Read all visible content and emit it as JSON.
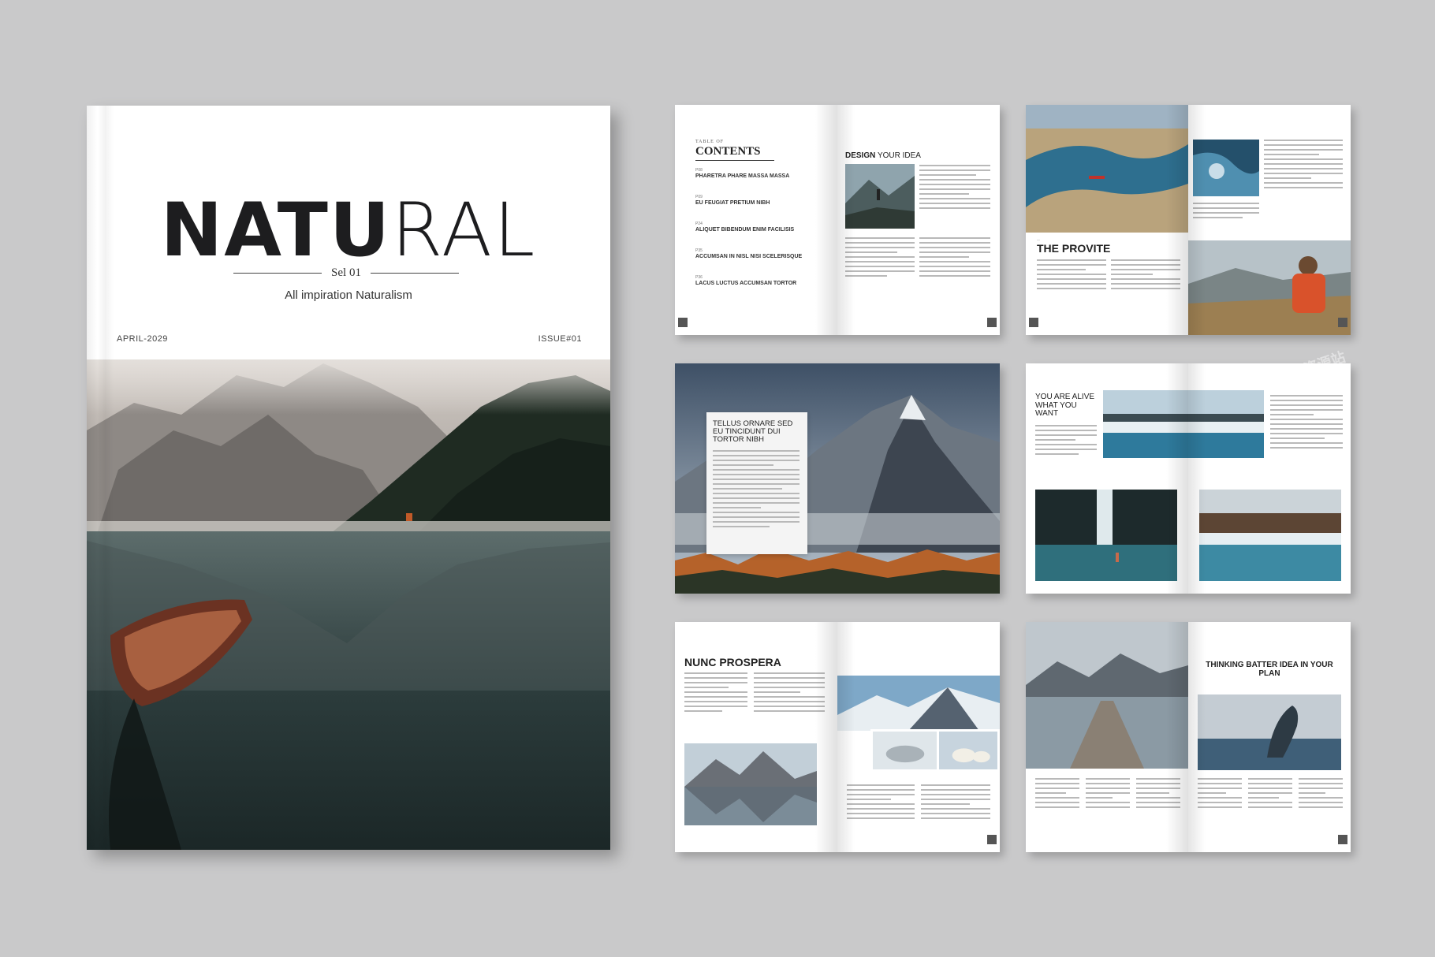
{
  "cover": {
    "title_bold": "NATU",
    "title_light": "RAL",
    "sel": "Sel 01",
    "subtitle": "All impiration Naturalism",
    "date": "APRIL-2029",
    "issue": "ISSUE#01"
  },
  "spreads": {
    "toc": {
      "label": "TABLE OF",
      "title": "CONTENTS",
      "items": [
        {
          "num": "P08",
          "text": "PHARETRA PHARE MASSA MASSA"
        },
        {
          "num": "P09",
          "text": "EU FEUGIAT PRETIUM NIBH"
        },
        {
          "num": "P24",
          "text": "ALIQUET BIBENDUM ENIM FACILISIS"
        },
        {
          "num": "P35",
          "text": "ACCUMSAN IN NISL NISI SCELERISQUE"
        },
        {
          "num": "P36",
          "text": "LACUS LUCTUS ACCUMSAN TORTOR"
        }
      ],
      "right_heading_bold": "DESIGN",
      "right_heading_light": " YOUR IDEA"
    },
    "provite": {
      "heading": "THE PROVITE"
    },
    "tellus": {
      "heading": "TELLUS ORNARE SED EU TINCIDUNT DUI TORTOR NIBH"
    },
    "alive": {
      "heading": "YOU ARE ALIVE WHAT YOU WANT"
    },
    "nunc": {
      "heading": "NUNC PROSPERA"
    },
    "thinking": {
      "heading": "THINKING BATTER IDEA IN YOUR PLAN"
    }
  },
  "watermark": "向日葵资源站"
}
